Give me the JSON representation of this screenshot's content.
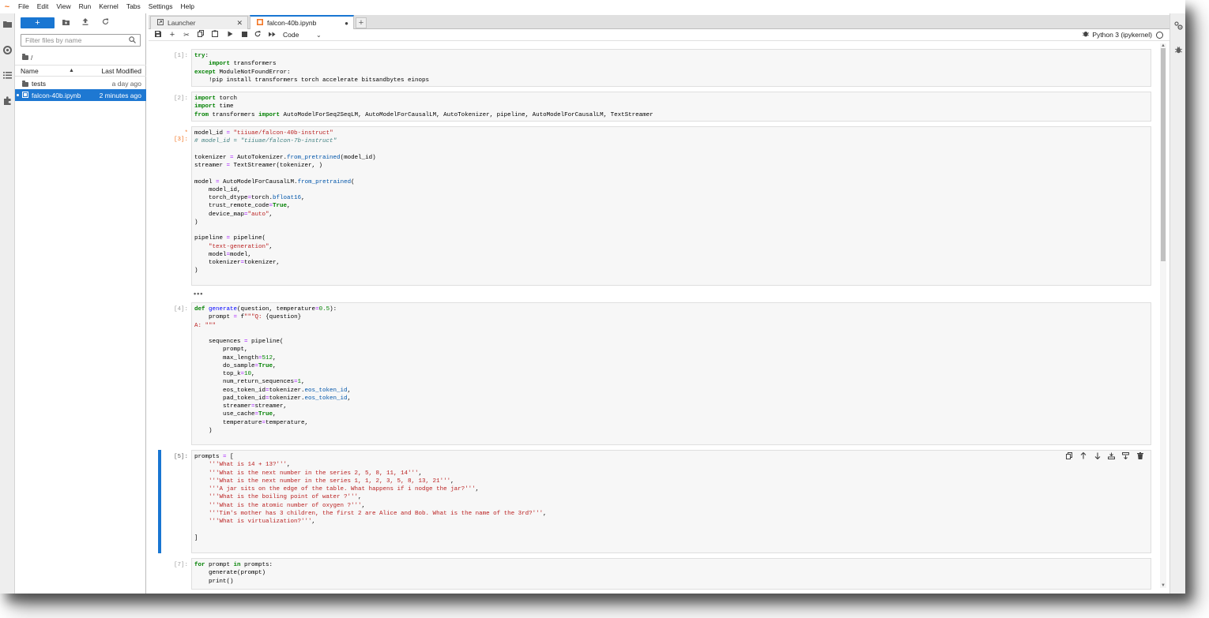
{
  "menubar": {
    "logo": "~",
    "items": [
      "File",
      "Edit",
      "View",
      "Run",
      "Kernel",
      "Tabs",
      "Settings",
      "Help"
    ]
  },
  "activitybar": {
    "icons": [
      "folder-icon",
      "running-icon",
      "toc-icon",
      "extension-icon"
    ]
  },
  "filebrowser": {
    "new_label": "+",
    "search_placeholder": "Filter files by name",
    "breadcrumb": "/",
    "columns": {
      "name": "Name",
      "modified": "Last Modified"
    },
    "rows": [
      {
        "name": "tests",
        "modified": "a day ago",
        "type": "folder"
      },
      {
        "name": "falcon-40b.ipynb",
        "modified": "2 minutes ago",
        "type": "notebook",
        "selected": true
      }
    ]
  },
  "tabs": [
    {
      "label": "Launcher",
      "active": false
    },
    {
      "label": "falcon-40b.ipynb",
      "active": true
    }
  ],
  "toolbar": {
    "cell_type": "Code",
    "kernel": "Python 3 (ipykernel)"
  },
  "cells": [
    {
      "prompt": "[1]:"
    },
    {
      "prompt": "[2]:"
    },
    {
      "prompt": "*[3]:"
    },
    {
      "prompt": "[4]:"
    },
    {
      "prompt": "[5]:"
    },
    {
      "prompt": "[7]:"
    }
  ],
  "output_collapsed": "•••",
  "colors": {
    "accent": "#1976d2",
    "selection": "#1e78d2",
    "keyword": "#008000",
    "string": "#ba2121",
    "comment": "#408080",
    "dirty_prompt": "#f37726"
  }
}
